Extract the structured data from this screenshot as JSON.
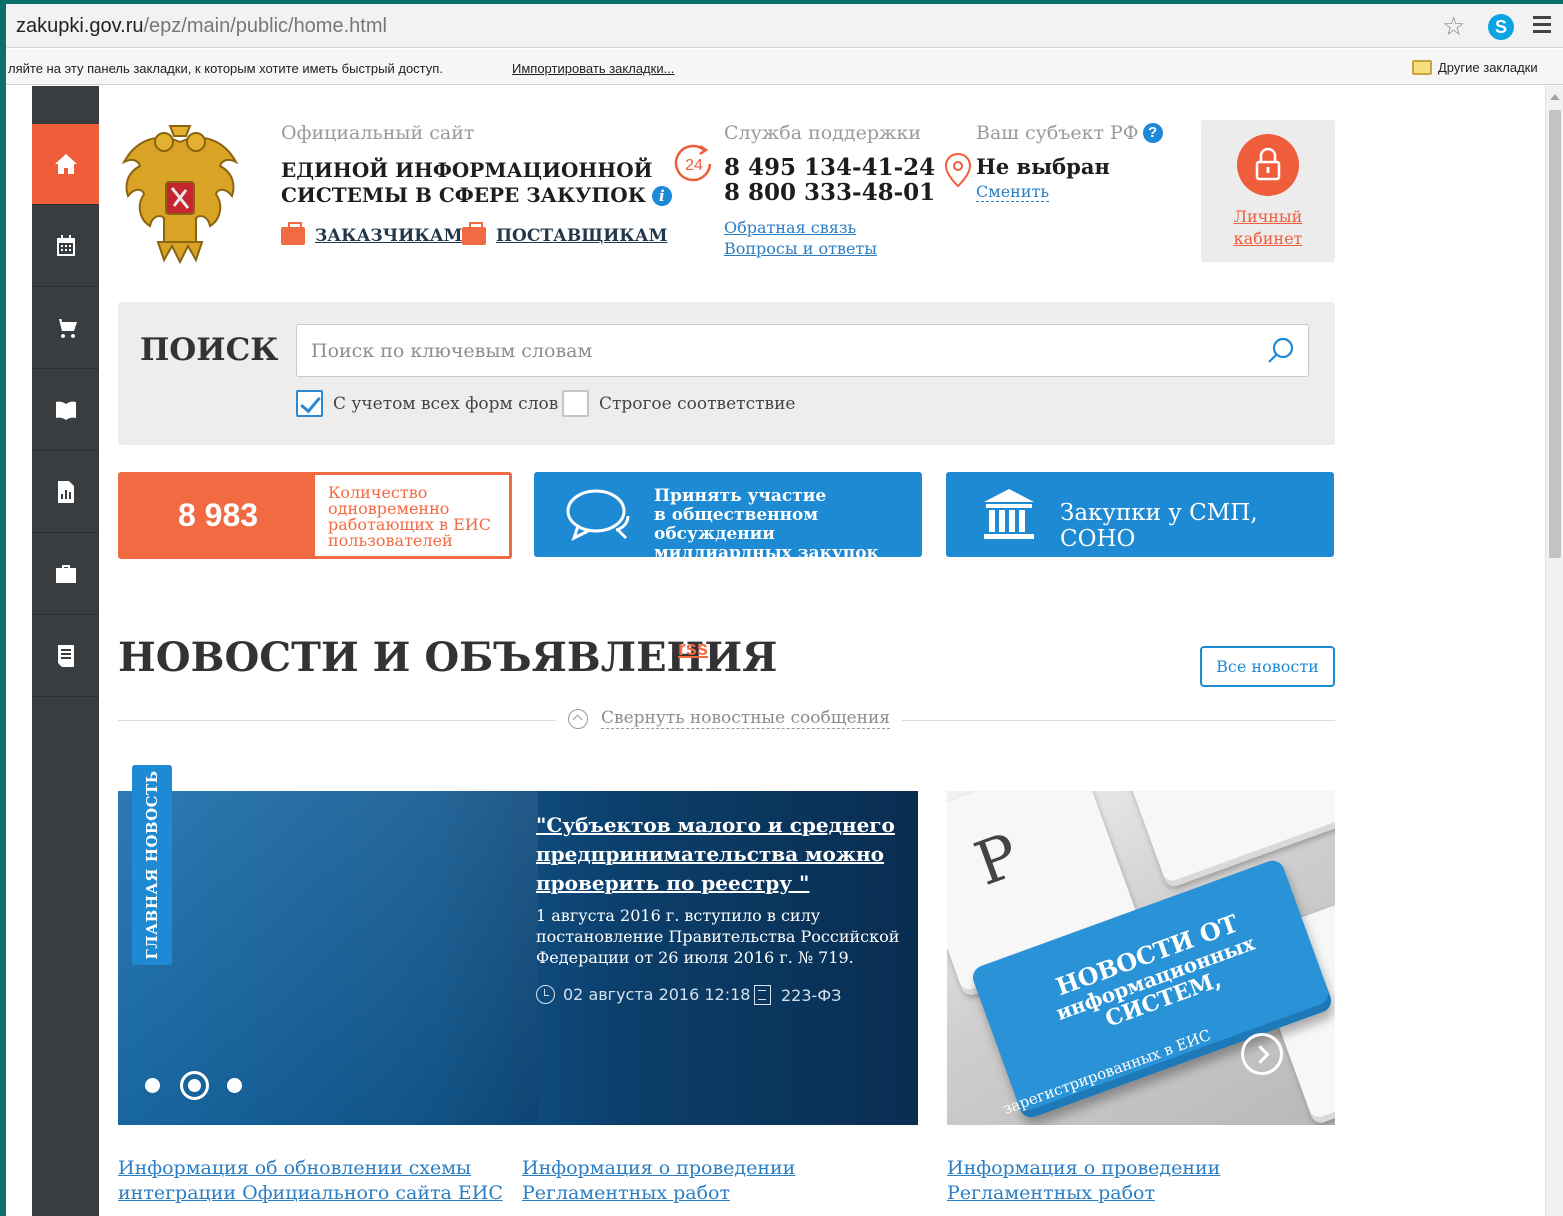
{
  "browser": {
    "url_host": "zakupki.gov.ru",
    "url_path": "/epz/main/public/home.html",
    "bookmarks_hint": "ляйте на эту панель закладки, к которым хотите иметь быстрый доступ.",
    "bookmarks_import": "Импортировать закладки...",
    "bookmarks_other": "Другие закладки",
    "skype_letter": "S"
  },
  "sidebar": {
    "items": [
      {
        "icon": "home-icon",
        "active": true
      },
      {
        "icon": "calendar-icon",
        "active": false
      },
      {
        "icon": "cart-icon",
        "active": false
      },
      {
        "icon": "book-icon",
        "active": false
      },
      {
        "icon": "report-icon",
        "active": false
      },
      {
        "icon": "briefcase-icon",
        "active": false
      },
      {
        "icon": "document-icon",
        "active": false
      }
    ]
  },
  "header": {
    "site_label": "Официальный сайт",
    "title_line1": "ЕДИНОЙ ИНФОРМАЦИОННОЙ",
    "title_line2": "СИСТЕМЫ В СФЕРЕ ЗАКУПОК",
    "info_glyph": "i",
    "customers_link": "ЗАКАЗЧИКАМ",
    "suppliers_link": "ПОСТАВЩИКАМ",
    "support_label": "Служба поддержки",
    "support_badge": "24",
    "phone1": "8 495 134-41-24",
    "phone2": "8 800 333-48-01",
    "feedback_link": "Обратная связь",
    "faq_link": "Вопросы и ответы",
    "region_label": "Ваш субъект РФ",
    "help_glyph": "?",
    "region_value": "Не выбран",
    "region_change": "Сменить",
    "cabinet_line1": "Личный",
    "cabinet_line2": "кабинет"
  },
  "search": {
    "title": "ПОИСК",
    "placeholder": "Поиск по ключевым словам",
    "value": "",
    "all_forms_label": "С учетом всех форм слов",
    "all_forms_checked": true,
    "strict_label": "Строгое соответствие",
    "strict_checked": false
  },
  "stats": {
    "online_users": "8 983",
    "online_label_1": "Количество",
    "online_label_2": "одновременно",
    "online_label_3": "работающих в ЕИС",
    "online_label_4": "пользователей"
  },
  "banners": {
    "discussion_1": "Принять участие",
    "discussion_2": "в общественном обсуждении",
    "discussion_3": "миллиардных закупок",
    "smp": "Закупки у СМП, СОНО"
  },
  "news": {
    "title": "НОВОСТИ И ОБЪЯВЛЕНИЯ",
    "rss": "rss",
    "all_news": "Все новости",
    "collapse": "Свернуть новостные сообщения",
    "ribbon": "ГЛАВНАЯ НОВОСТЬ",
    "main_title_1": "\"Субъектов малого и среднего",
    "main_title_2": "предпринимательства можно",
    "main_title_3": "проверить по реестру \"",
    "main_body_1": "1 августа 2016 г. вступило в силу",
    "main_body_2": "постановление Правительства Российской",
    "main_body_3": "Федерации от 26 июля 2016 г. № 719.",
    "main_date": "02 августа 2016 12:18",
    "main_law": "223-ФЗ",
    "slide_count": 3,
    "active_slide": 2,
    "promo_key_letter": "P",
    "promo_line1": "НОВОСТИ ОТ",
    "promo_line2": "информационных",
    "promo_line3": "СИСТЕМ,",
    "promo_line4": "зарегистрированных в ЕИС",
    "links": [
      {
        "line1": "Информация об обновлении схемы",
        "line2": "интеграции Официального сайта ЕИС"
      },
      {
        "line1": "Информация о проведении",
        "line2": "Регламентных работ"
      },
      {
        "line1": "Информация о проведении",
        "line2": "Регламентных работ"
      }
    ]
  },
  "colors": {
    "accent_orange": "#ef5d3b",
    "accent_blue": "#1f8ad4",
    "link_blue": "#2b7ec4",
    "sidebar": "#3a3d3f"
  }
}
